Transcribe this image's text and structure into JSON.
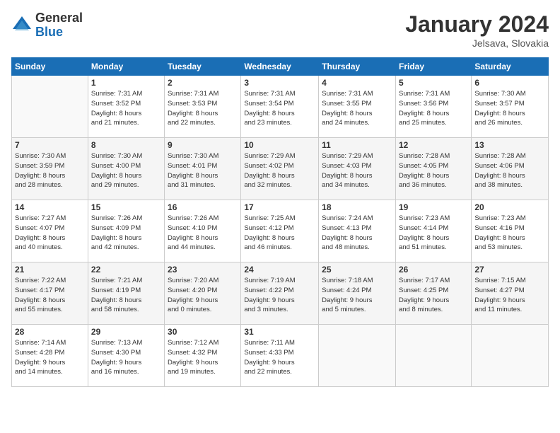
{
  "logo": {
    "general": "General",
    "blue": "Blue"
  },
  "title": "January 2024",
  "subtitle": "Jelsava, Slovakia",
  "headers": [
    "Sunday",
    "Monday",
    "Tuesday",
    "Wednesday",
    "Thursday",
    "Friday",
    "Saturday"
  ],
  "weeks": [
    [
      {
        "day": "",
        "info": ""
      },
      {
        "day": "1",
        "info": "Sunrise: 7:31 AM\nSunset: 3:52 PM\nDaylight: 8 hours\nand 21 minutes."
      },
      {
        "day": "2",
        "info": "Sunrise: 7:31 AM\nSunset: 3:53 PM\nDaylight: 8 hours\nand 22 minutes."
      },
      {
        "day": "3",
        "info": "Sunrise: 7:31 AM\nSunset: 3:54 PM\nDaylight: 8 hours\nand 23 minutes."
      },
      {
        "day": "4",
        "info": "Sunrise: 7:31 AM\nSunset: 3:55 PM\nDaylight: 8 hours\nand 24 minutes."
      },
      {
        "day": "5",
        "info": "Sunrise: 7:31 AM\nSunset: 3:56 PM\nDaylight: 8 hours\nand 25 minutes."
      },
      {
        "day": "6",
        "info": "Sunrise: 7:30 AM\nSunset: 3:57 PM\nDaylight: 8 hours\nand 26 minutes."
      }
    ],
    [
      {
        "day": "7",
        "info": "Sunrise: 7:30 AM\nSunset: 3:59 PM\nDaylight: 8 hours\nand 28 minutes."
      },
      {
        "day": "8",
        "info": "Sunrise: 7:30 AM\nSunset: 4:00 PM\nDaylight: 8 hours\nand 29 minutes."
      },
      {
        "day": "9",
        "info": "Sunrise: 7:30 AM\nSunset: 4:01 PM\nDaylight: 8 hours\nand 31 minutes."
      },
      {
        "day": "10",
        "info": "Sunrise: 7:29 AM\nSunset: 4:02 PM\nDaylight: 8 hours\nand 32 minutes."
      },
      {
        "day": "11",
        "info": "Sunrise: 7:29 AM\nSunset: 4:03 PM\nDaylight: 8 hours\nand 34 minutes."
      },
      {
        "day": "12",
        "info": "Sunrise: 7:28 AM\nSunset: 4:05 PM\nDaylight: 8 hours\nand 36 minutes."
      },
      {
        "day": "13",
        "info": "Sunrise: 7:28 AM\nSunset: 4:06 PM\nDaylight: 8 hours\nand 38 minutes."
      }
    ],
    [
      {
        "day": "14",
        "info": "Sunrise: 7:27 AM\nSunset: 4:07 PM\nDaylight: 8 hours\nand 40 minutes."
      },
      {
        "day": "15",
        "info": "Sunrise: 7:26 AM\nSunset: 4:09 PM\nDaylight: 8 hours\nand 42 minutes."
      },
      {
        "day": "16",
        "info": "Sunrise: 7:26 AM\nSunset: 4:10 PM\nDaylight: 8 hours\nand 44 minutes."
      },
      {
        "day": "17",
        "info": "Sunrise: 7:25 AM\nSunset: 4:12 PM\nDaylight: 8 hours\nand 46 minutes."
      },
      {
        "day": "18",
        "info": "Sunrise: 7:24 AM\nSunset: 4:13 PM\nDaylight: 8 hours\nand 48 minutes."
      },
      {
        "day": "19",
        "info": "Sunrise: 7:23 AM\nSunset: 4:14 PM\nDaylight: 8 hours\nand 51 minutes."
      },
      {
        "day": "20",
        "info": "Sunrise: 7:23 AM\nSunset: 4:16 PM\nDaylight: 8 hours\nand 53 minutes."
      }
    ],
    [
      {
        "day": "21",
        "info": "Sunrise: 7:22 AM\nSunset: 4:17 PM\nDaylight: 8 hours\nand 55 minutes."
      },
      {
        "day": "22",
        "info": "Sunrise: 7:21 AM\nSunset: 4:19 PM\nDaylight: 8 hours\nand 58 minutes."
      },
      {
        "day": "23",
        "info": "Sunrise: 7:20 AM\nSunset: 4:20 PM\nDaylight: 9 hours\nand 0 minutes."
      },
      {
        "day": "24",
        "info": "Sunrise: 7:19 AM\nSunset: 4:22 PM\nDaylight: 9 hours\nand 3 minutes."
      },
      {
        "day": "25",
        "info": "Sunrise: 7:18 AM\nSunset: 4:24 PM\nDaylight: 9 hours\nand 5 minutes."
      },
      {
        "day": "26",
        "info": "Sunrise: 7:17 AM\nSunset: 4:25 PM\nDaylight: 9 hours\nand 8 minutes."
      },
      {
        "day": "27",
        "info": "Sunrise: 7:15 AM\nSunset: 4:27 PM\nDaylight: 9 hours\nand 11 minutes."
      }
    ],
    [
      {
        "day": "28",
        "info": "Sunrise: 7:14 AM\nSunset: 4:28 PM\nDaylight: 9 hours\nand 14 minutes."
      },
      {
        "day": "29",
        "info": "Sunrise: 7:13 AM\nSunset: 4:30 PM\nDaylight: 9 hours\nand 16 minutes."
      },
      {
        "day": "30",
        "info": "Sunrise: 7:12 AM\nSunset: 4:32 PM\nDaylight: 9 hours\nand 19 minutes."
      },
      {
        "day": "31",
        "info": "Sunrise: 7:11 AM\nSunset: 4:33 PM\nDaylight: 9 hours\nand 22 minutes."
      },
      {
        "day": "",
        "info": ""
      },
      {
        "day": "",
        "info": ""
      },
      {
        "day": "",
        "info": ""
      }
    ]
  ]
}
